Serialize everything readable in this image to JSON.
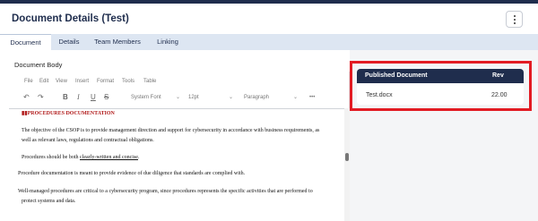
{
  "header": {
    "title": "Document Details (Test)"
  },
  "tabs": [
    {
      "label": "Document"
    },
    {
      "label": "Details"
    },
    {
      "label": "Team Members"
    },
    {
      "label": "Linking"
    }
  ],
  "editor": {
    "label": "Document Body",
    "menu": [
      "File",
      "Edit",
      "View",
      "Insert",
      "Format",
      "Tools",
      "Table"
    ],
    "toolbar": {
      "font": "System Font",
      "size": "12pt",
      "block": "Paragraph",
      "more": "•••"
    },
    "content": {
      "heading": "PROCEDURES DOCUMENTATION",
      "p1a": "The objective of the CSOP is to provide management direction and support for cybersecurity in accordance with business requirements, as",
      "p1b": "well as relevant laws, regulations and contractual obligations.",
      "p2_prefix": "Procedures should be both ",
      "p2_underlined": "clearly-written and concise",
      "p2_suffix": ".",
      "p3": "Procedure documentation is meant to provide evidence of due diligence that standards are complied with.",
      "p4a": "Well-managed procedures are critical to a cybersecurity program, since procedures represents the specific activities that are performed to",
      "p4b": "protect systems and data."
    }
  },
  "published": {
    "header_doc": "Published Document",
    "header_rev": "Rev",
    "file": "Test.docx",
    "rev": "22.00"
  }
}
